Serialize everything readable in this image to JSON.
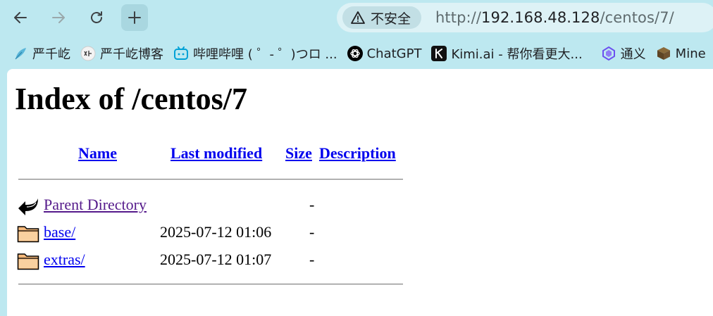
{
  "browser": {
    "security_label": "不安全",
    "url_scheme": "http://",
    "url_host": "192.168.48.128",
    "url_path": "/centos/7/"
  },
  "bookmarks": [
    {
      "label": "严千屹",
      "icon": "feather-icon"
    },
    {
      "label": "严千屹博客",
      "icon": "blog-logo-icon"
    },
    {
      "label": "哔哩哔哩 ( ゜- ゜)つロ ...",
      "icon": "bilibili-icon"
    },
    {
      "label": "ChatGPT",
      "icon": "openai-icon"
    },
    {
      "label": "Kimi.ai - 帮你看更大...",
      "icon": "kimi-icon"
    },
    {
      "label": "通义",
      "icon": "tongyi-icon"
    },
    {
      "label": "Mine",
      "icon": "minecraft-block-icon"
    }
  ],
  "page": {
    "title": "Index of /centos/7",
    "columns": {
      "name": "Name",
      "last_modified": "Last modified",
      "size": "Size",
      "description": "Description"
    },
    "rows": [
      {
        "name": "Parent Directory",
        "modified": "",
        "size": "-",
        "icon": "back-arrow-icon"
      },
      {
        "name": "base/",
        "modified": "2025-07-12 01:06",
        "size": "-",
        "icon": "folder-icon"
      },
      {
        "name": "extras/",
        "modified": "2025-07-12 01:07",
        "size": "-",
        "icon": "folder-icon"
      }
    ]
  },
  "colors": {
    "chrome_background": "#bde8f0",
    "link": "#0000ee",
    "visited_link": "#551a8b"
  }
}
